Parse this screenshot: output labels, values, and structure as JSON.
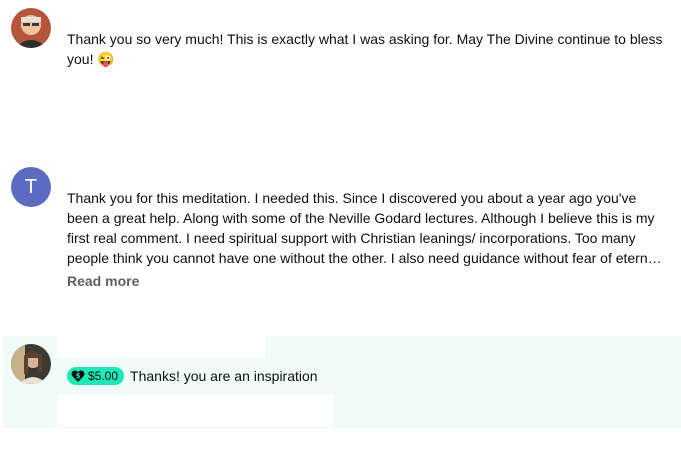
{
  "comments": [
    {
      "avatar": {
        "type": "photo",
        "colors": [
          "#c56b48",
          "#8c4a33",
          "#f2c9a8"
        ]
      },
      "lines": [
        "Thank you so very much! This is exactly what I was asking for. May The Divine continue to bless",
        "you! 😜"
      ]
    },
    {
      "avatar": {
        "type": "letter",
        "letter": "T",
        "color": "#5c6bc0"
      },
      "lines": [
        "Thank you for this meditation.   I needed this.   Since I discovered you about a year ago you've",
        "been a great help. Along with some of the Neville Godard lectures.  Although I believe this is my",
        "first real comment.  I need spiritual support with Christian leanings/ incorporations.   Too many",
        "people think you cannot have one without the other.  I also need guidance without fear of eternal damnation..."
      ],
      "read_more": "Read more"
    },
    {
      "avatar": {
        "type": "photo",
        "colors": [
          "#3b3a33",
          "#c8b08a",
          "#6e5b45"
        ]
      },
      "thanks": {
        "amount": "$5.00",
        "text": "Thanks! you are an inspiration",
        "chip_color": "#1de9b6",
        "panel_color": "#f1fcf8"
      }
    }
  ]
}
